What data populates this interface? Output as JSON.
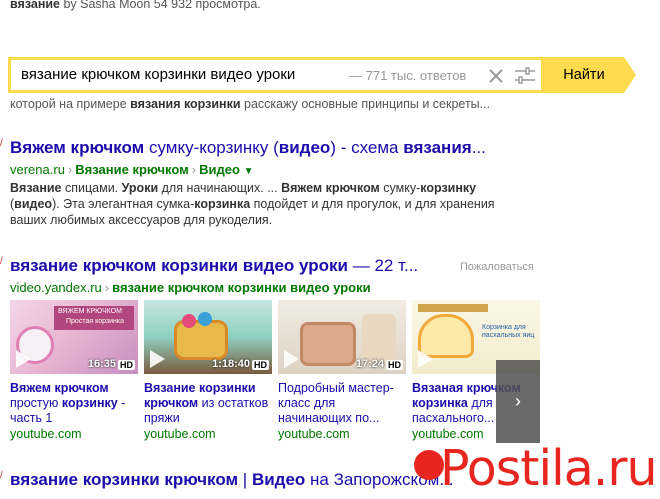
{
  "top_snippet": {
    "bold": "вязание",
    "rest": " by Sasha Moon 54 932 просмотра."
  },
  "search": {
    "query": "вязание крючком корзинки видео уроки",
    "count": "— 771 тыс. ответов",
    "button_label": "Найти"
  },
  "partial_snippet": {
    "part1": "которой на примере ",
    "bold": "вязания корзинки",
    "part2": " расскажу основные принципы и секреты..."
  },
  "result1": {
    "title_bold1": "Вяжем крючком",
    "title_light1": " сумку-корзинку (",
    "title_bold2": "видео",
    "title_light2": ") - схема ",
    "title_bold3": "вязания",
    "title_light3": "...",
    "domain": "verena.ru",
    "crumb1": "Вязание крючком",
    "crumb2": "Видео",
    "snippet": [
      {
        "t": "Вязание",
        "b": true
      },
      {
        "t": " спицами. ",
        "b": false
      },
      {
        "t": "Уроки",
        "b": true
      },
      {
        "t": " для начинающих. ... ",
        "b": false
      },
      {
        "t": "Вяжем крючком",
        "b": true
      },
      {
        "t": " сумку-",
        "b": false
      },
      {
        "t": "корзинку",
        "b": true
      },
      {
        "t": " (",
        "b": false
      },
      {
        "t": "видео",
        "b": true
      },
      {
        "t": "). Эта элегантная сумка-",
        "b": false
      },
      {
        "t": "корзинка",
        "b": true
      },
      {
        "t": " подойдет и для прогулок, и для хранения ваших любимых аксессуаров для рукоделия.",
        "b": false
      }
    ]
  },
  "result2": {
    "title_bold": "вязание крючком корзинки видео уроки",
    "title_light": " — 22 т...",
    "complain": "Пожаловаться",
    "domain": "video.yandex.ru",
    "crumb": "вязание крючком корзинки видео уроки"
  },
  "videos": [
    {
      "duration": "16:35",
      "hd": "HD",
      "title_parts": [
        {
          "t": "Вяжем крючком",
          "b": true
        },
        {
          "t": " простую ",
          "b": false
        },
        {
          "t": "корзинку",
          "b": true
        },
        {
          "t": " - часть 1",
          "b": false
        }
      ],
      "source": "youtube.com",
      "thumb_text": "ВЯЖЕМ КРЮЧКОМ",
      "thumb_text2": "Простая корзинка"
    },
    {
      "duration": "1:18:40",
      "hd": "HD",
      "title_parts": [
        {
          "t": "Вязание корзинки крючком",
          "b": true
        },
        {
          "t": " из остатков пряжи",
          "b": false
        }
      ],
      "source": "youtube.com"
    },
    {
      "duration": "17:24",
      "hd": "HD",
      "title_parts": [
        {
          "t": "Подробный мастер-класс для начинающих по...",
          "b": false
        }
      ],
      "source": "youtube.com"
    },
    {
      "duration": "",
      "hd": "",
      "title_parts": [
        {
          "t": "Вязаная",
          "b": true
        },
        {
          "t": " ",
          "b": false
        },
        {
          "t": "крючком корзинка",
          "b": true
        },
        {
          "t": " для пасхального...",
          "b": false
        }
      ],
      "source": "youtube.com",
      "thumb_text": "Корзинка для пасхальных яиц"
    }
  ],
  "result3": {
    "title_bold1": "вязание корзинки крючком",
    "title_light1": " | ",
    "title_bold2": "Видео",
    "title_light2": " на Запорожском..."
  },
  "watermark": {
    "text": "Postila.ru"
  },
  "colors": {
    "link": "#1a0dab",
    "url": "#007700",
    "search_accent": "#ffdb4d",
    "watermark": "#e8251f"
  }
}
